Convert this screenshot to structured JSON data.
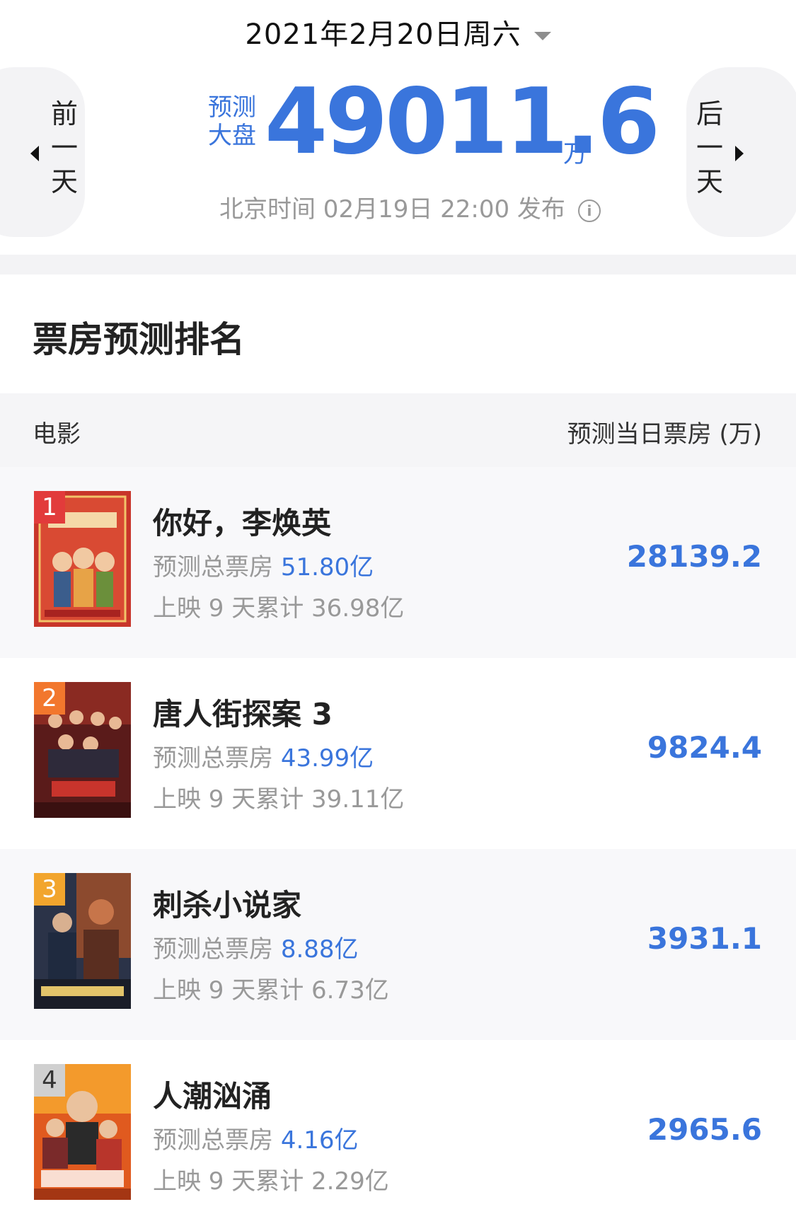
{
  "header": {
    "date": "2021年2月20日周六",
    "prev_day": [
      "前",
      "一",
      "天"
    ],
    "next_day": [
      "后",
      "一",
      "天"
    ],
    "forecast_label": [
      "预测",
      "大盘"
    ],
    "forecast_value": "49011.6",
    "forecast_unit": "万",
    "publish_time": "北京时间 02月19日 22:00 发布"
  },
  "section": {
    "title": "票房预测排名",
    "col_movie": "电影",
    "col_value": "预测当日票房 (万)"
  },
  "colors": {
    "accent": "#3a75dc",
    "rank1": "#e23b3b",
    "rank2": "#f2772d",
    "rank3": "#f2a52d",
    "rank4": "#d0d0d0"
  },
  "movies": [
    {
      "rank": "1",
      "title": "你好，李焕英",
      "pred_label": "预测总票房",
      "pred_total": "51.80亿",
      "cum": "上映 9 天累计 36.98亿",
      "value": "28139.2"
    },
    {
      "rank": "2",
      "title": "唐人街探案 3",
      "pred_label": "预测总票房",
      "pred_total": "43.99亿",
      "cum": "上映 9 天累计 39.11亿",
      "value": "9824.4"
    },
    {
      "rank": "3",
      "title": "刺杀小说家",
      "pred_label": "预测总票房",
      "pred_total": "8.88亿",
      "cum": "上映 9 天累计 6.73亿",
      "value": "3931.1"
    },
    {
      "rank": "4",
      "title": "人潮汹涌",
      "pred_label": "预测总票房",
      "pred_total": "4.16亿",
      "cum": "上映 9 天累计 2.29亿",
      "value": "2965.6"
    }
  ]
}
